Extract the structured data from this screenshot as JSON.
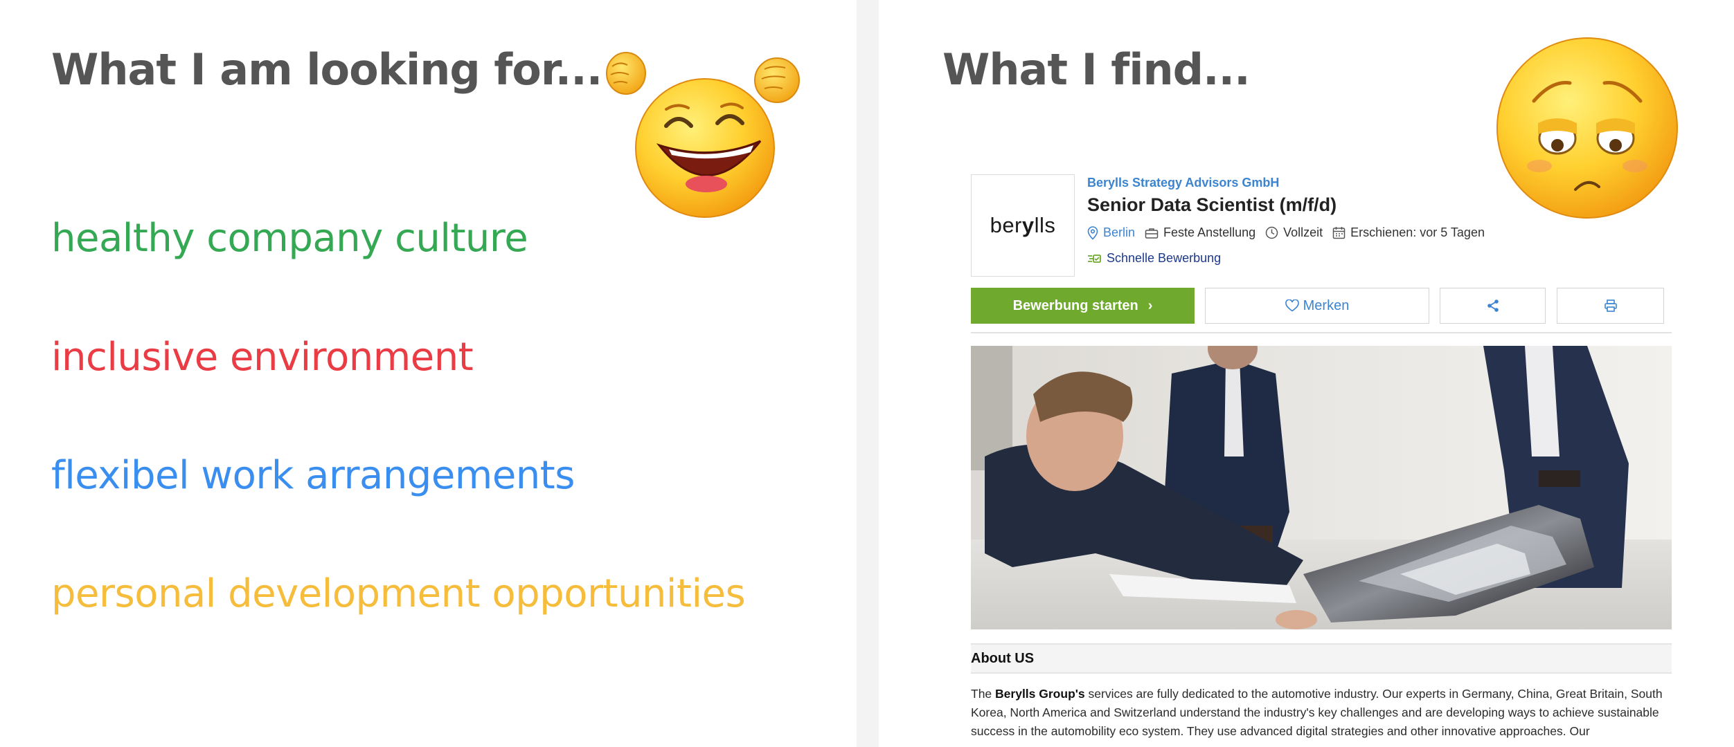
{
  "left": {
    "heading": "What I am looking for...",
    "wishes": [
      {
        "text": "healthy company culture",
        "color": "#34a853"
      },
      {
        "text": "inclusive environment",
        "color": "#ea3c44"
      },
      {
        "text": "flexibel work arrangements",
        "color": "#3a8ef0"
      },
      {
        "text": "personal development opportunities",
        "color": "#f6bd3c"
      }
    ],
    "emoji": "cheering-laughing-emoji"
  },
  "right": {
    "heading": "What I find...",
    "emoji": "sad-tired-emoji",
    "job": {
      "logo": {
        "pre": "ber",
        "y": "y",
        "post": "lls"
      },
      "company": "Berylls Strategy Advisors GmbH",
      "title": "Senior Data Scientist (m/f/d)",
      "location": "Berlin",
      "employment": "Feste Anstellung",
      "hours": "Vollzeit",
      "posted": "Erschienen: vor 5 Tagen",
      "quick_apply": "Schnelle Bewerbung",
      "apply_label": "Bewerbung starten",
      "save_label": "Merken",
      "icons": {
        "location": "location-pin-icon",
        "employment": "briefcase-icon",
        "hours": "clock-icon",
        "posted": "calendar-icon",
        "quick": "fast-apply-icon",
        "share": "share-icon",
        "print": "print-icon",
        "save": "heart-icon"
      },
      "about_title": "About US",
      "about": {
        "lead": "The ",
        "strong": "Berylls Group's",
        "rest": " services are fully dedicated to the automotive industry. Our experts in Germany, China, Great Britain, South Korea, North America and Switzerland understand the industry's key challenges and are developing ways to achieve sustainable success in the automobility eco system. They use advanced digital strategies and other innovative approaches. Our"
      },
      "colors": {
        "apply": "#6faa2e",
        "link": "#3c84cf",
        "quick": "#1d3a8a"
      }
    }
  }
}
